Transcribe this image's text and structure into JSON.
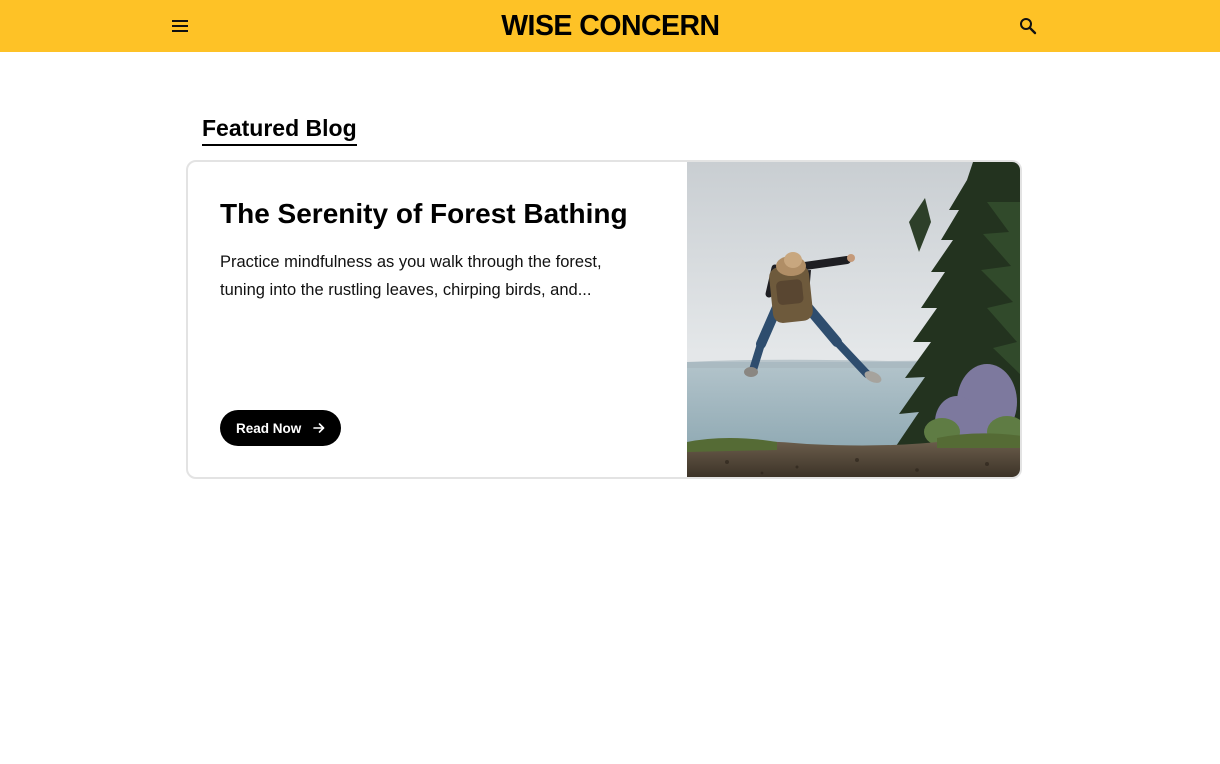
{
  "header": {
    "brand": "WISE CONCERN",
    "menu_icon": "hamburger-menu-icon",
    "search_icon": "search-icon",
    "background_color": "#fec226"
  },
  "featured": {
    "section_title": "Featured Blog",
    "card": {
      "title": "The Serenity of Forest Bathing",
      "excerpt_line1": "Practice mindfulness as you walk through the forest,",
      "excerpt_line2": "tuning into the rustling leaves, chirping birds, and...",
      "button_label": "Read Now",
      "button_icon": "arrow-right-icon",
      "image_alt": "Hiker with backpack jumping joyfully beside a lake and pine trees"
    }
  }
}
